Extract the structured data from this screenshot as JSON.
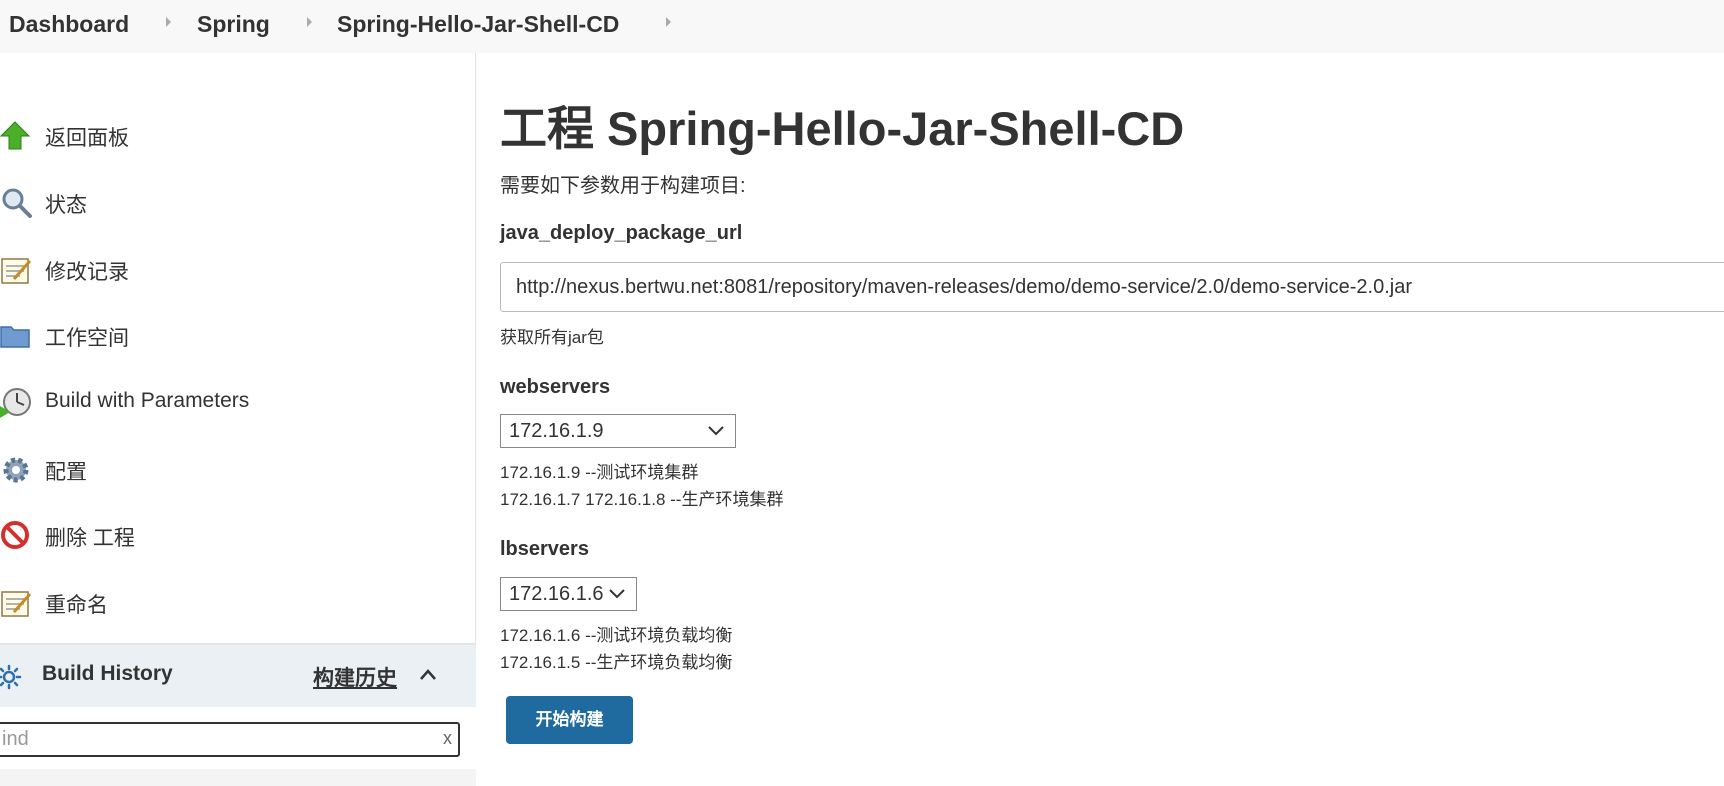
{
  "breadcrumb": {
    "items": [
      {
        "label": "Dashboard"
      },
      {
        "label": "Spring"
      },
      {
        "label": "Spring-Hello-Jar-Shell-CD"
      }
    ]
  },
  "sidebar": {
    "items": [
      {
        "label": "返回面板",
        "icon": "up-arrow-icon"
      },
      {
        "label": "状态",
        "icon": "search-icon"
      },
      {
        "label": "修改记录",
        "icon": "notepad-icon"
      },
      {
        "label": "工作空间",
        "icon": "folder-icon"
      },
      {
        "label": "Build with Parameters",
        "icon": "clock-icon"
      },
      {
        "label": "配置",
        "icon": "gear-icon"
      },
      {
        "label": "删除 工程",
        "icon": "no-entry-icon"
      },
      {
        "label": "重命名",
        "icon": "notepad-icon"
      }
    ],
    "build_history": {
      "title": "Build History",
      "link": "构建历史",
      "find_value": "ind"
    }
  },
  "main": {
    "title": "工程 Spring-Hello-Jar-Shell-CD",
    "intro": "需要如下参数用于构建项目:",
    "params": {
      "url": {
        "name": "java_deploy_package_url",
        "value": "http://nexus.bertwu.net:8081/repository/maven-releases/demo/demo-service/2.0/demo-service-2.0.jar",
        "description": "获取所有jar包"
      },
      "webservers": {
        "name": "webservers",
        "selected": "172.16.1.9",
        "description_lines": [
          "172.16.1.9 --测试环境集群",
          "172.16.1.7 172.16.1.8 --生产环境集群"
        ]
      },
      "lbservers": {
        "name": "lbservers",
        "selected": "172.16.1.6",
        "description_lines": [
          "172.16.1.6 --测试环境负载均衡",
          "172.16.1.5 --生产环境负载均衡"
        ]
      }
    },
    "build_button": "开始构建"
  },
  "colors": {
    "build_button": "#1f6a9e",
    "breadcrumb_bg": "#f8f8f8",
    "history_header_bg": "#eaf0f4"
  }
}
